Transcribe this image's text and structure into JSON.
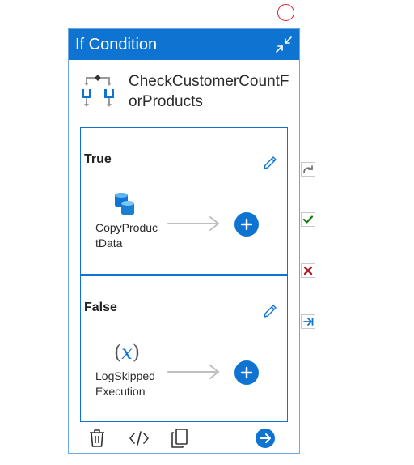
{
  "card": {
    "header_title": "If Condition",
    "activity_name": "CheckCustomerCountForProducts"
  },
  "branches": {
    "true": {
      "label": "True",
      "activity_name": "CopyProductData",
      "icon": "copy-data-icon"
    },
    "false": {
      "label": "False",
      "activity_name": "LogSkippedExecution",
      "icon": "set-variable-icon"
    }
  },
  "footer": {
    "icons": [
      "delete-icon",
      "code-icon",
      "clone-icon",
      "go-to-icon"
    ]
  },
  "side_connectors": {
    "icons": [
      "skipped-connector-icon",
      "success-connector-icon",
      "failure-connector-icon",
      "completion-connector-icon"
    ]
  },
  "colors": {
    "accent": "#0f74d1",
    "success": "#107c10",
    "failure": "#a4262c",
    "top_circle": "#d9232f"
  }
}
